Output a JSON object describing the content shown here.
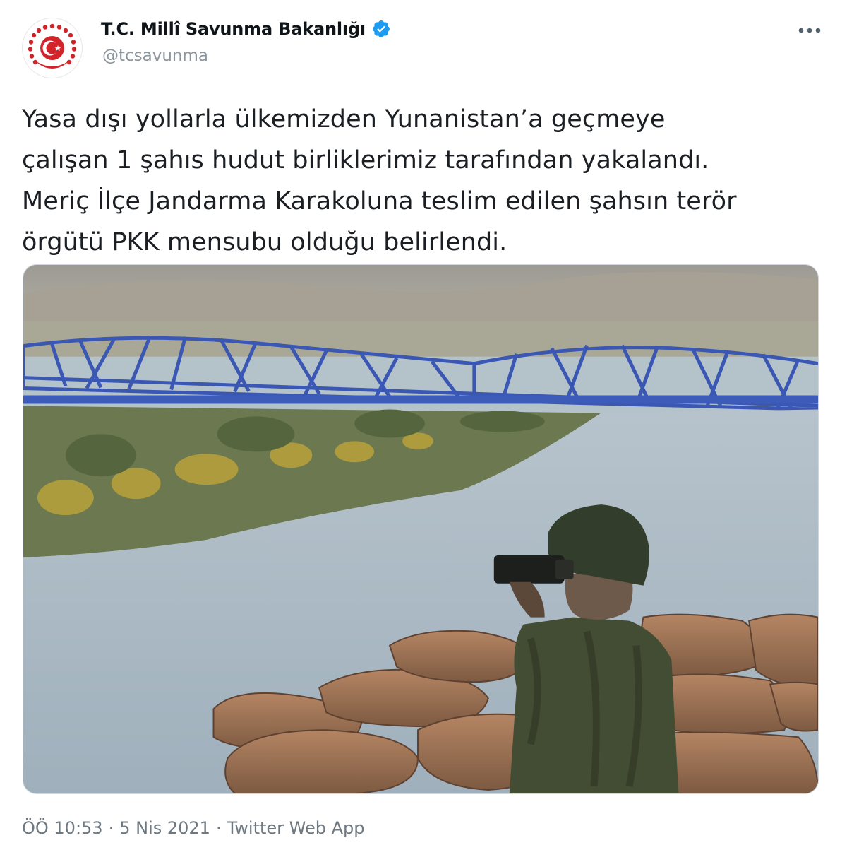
{
  "tweet": {
    "author": {
      "display_name": "T.C. Millî Savunma Bakanlığı",
      "handle": "@tcsavunma",
      "verified": true,
      "avatar_icon": "ministry-emblem-icon"
    },
    "text": "Yasa dışı yollarla ülkemizden Yunanistan’a geçmeye\nçalışan 1 şahıs hudut birliklerimiz tarafından yakalandı.\nMeriç İlçe Jandarma Karakoluna teslim edilen şahsın terör\nörgütü PKK mensubu olduğu belirlendi.",
    "media": {
      "kind": "photo",
      "description_icon": "border-patrol-photo"
    },
    "timestamp": {
      "time": "ÖÖ 10:53",
      "date": "5 Nis 2021",
      "source": "Twitter Web App",
      "separator": "·"
    }
  },
  "colors": {
    "verified_badge": "#1d9bf0",
    "emblem_red": "#d3232a",
    "muted_text": "#6e7880"
  }
}
